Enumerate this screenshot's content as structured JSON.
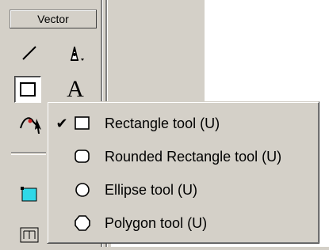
{
  "toolbar": {
    "section_title": "Vector",
    "tools": {
      "line": "line-tool",
      "pen": "pen-tool",
      "rectangle": "rectangle-tool",
      "text": "A",
      "freeform": "freeform-tool",
      "fill": "fill-tool",
      "bottom": "bottom-tool"
    }
  },
  "flyout_menu": {
    "items": [
      {
        "label": "Rectangle tool (U)",
        "checked": true,
        "icon": "rectangle-icon"
      },
      {
        "label": "Rounded Rectangle tool (U)",
        "checked": false,
        "icon": "rounded-rectangle-icon"
      },
      {
        "label": "Ellipse tool (U)",
        "checked": false,
        "icon": "ellipse-icon"
      },
      {
        "label": "Polygon tool (U)",
        "checked": false,
        "icon": "polygon-icon"
      }
    ],
    "check_glyph": "✔"
  },
  "colors": {
    "panel": "#d4d0c8",
    "workspace": "#ffffff",
    "accent_cyan": "#2fd8e8"
  }
}
